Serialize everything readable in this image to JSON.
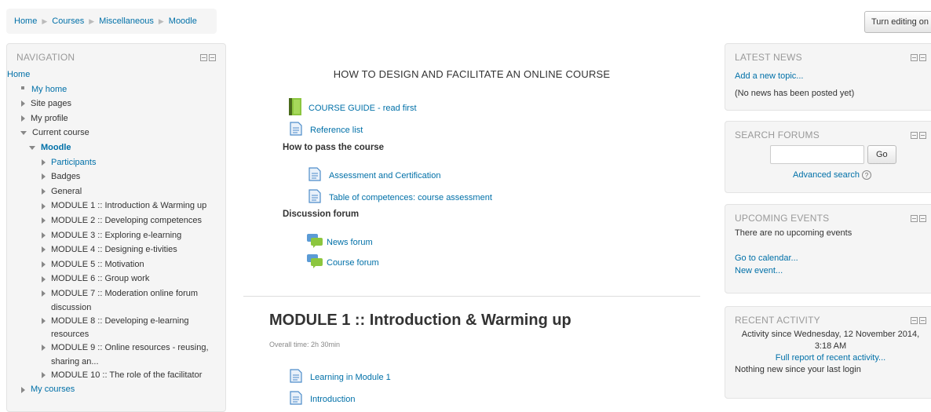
{
  "breadcrumb": [
    "Home",
    "Courses",
    "Miscellaneous",
    "Moodle"
  ],
  "edit_button": "Turn editing on",
  "navigation": {
    "title": "NAVIGATION",
    "home": "Home",
    "my_home": "My home",
    "site_pages": "Site pages",
    "my_profile": "My profile",
    "current_course": "Current course",
    "course": "Moodle",
    "items": [
      "Participants",
      "Badges",
      "General",
      "MODULE 1 :: Introduction & Warming up",
      "MODULE 2 :: Developing competences",
      "MODULE 3 :: Exploring e-learning",
      "MODULE 4 :: Designing e-tivities",
      "MODULE 5 :: Motivation",
      "MODULE 6 :: Group work",
      "MODULE 7 :: Moderation online forum",
      "MODULE 8 :: Developing e-learning",
      "MODULE 9 :: Online resources - reusing,",
      "MODULE 10 :: The role of the facilitator"
    ],
    "item7_cont": "discussion",
    "item8_cont": "resources",
    "item9_cont": "sharing an...",
    "my_courses": "My courses"
  },
  "main": {
    "course_title": "HOW TO DESIGN AND FACILITATE AN ONLINE COURSE",
    "course_guide": "COURSE GUIDE - read first",
    "reference_list": "Reference list",
    "how_to_pass": "How to pass the course",
    "assessment": "Assessment and Certification",
    "competences": "Table of competences: course assessment",
    "discussion_forum": "Discussion forum",
    "news_forum": "News forum",
    "course_forum": "Course forum",
    "module_title": "MODULE 1 :: Introduction & Warming up",
    "overall_time": "Overall time: 2h 30min",
    "learning": "Learning in Module 1",
    "introduction": "Introduction"
  },
  "latest_news": {
    "title": "LATEST NEWS",
    "add": "Add a new topic...",
    "none": "(No news has been posted yet)"
  },
  "search_forums": {
    "title": "SEARCH FORUMS",
    "go": "Go",
    "advanced": "Advanced search"
  },
  "upcoming_events": {
    "title": "UPCOMING EVENTS",
    "none": "There are no upcoming events",
    "calendar": "Go to calendar...",
    "new_event": "New event..."
  },
  "recent_activity": {
    "title": "RECENT ACTIVITY",
    "since_line1": "Activity since Wednesday, 12 November 2014,",
    "since_line2": "3:18 AM",
    "full_report": "Full report of recent activity...",
    "nothing": "Nothing new since your last login"
  }
}
